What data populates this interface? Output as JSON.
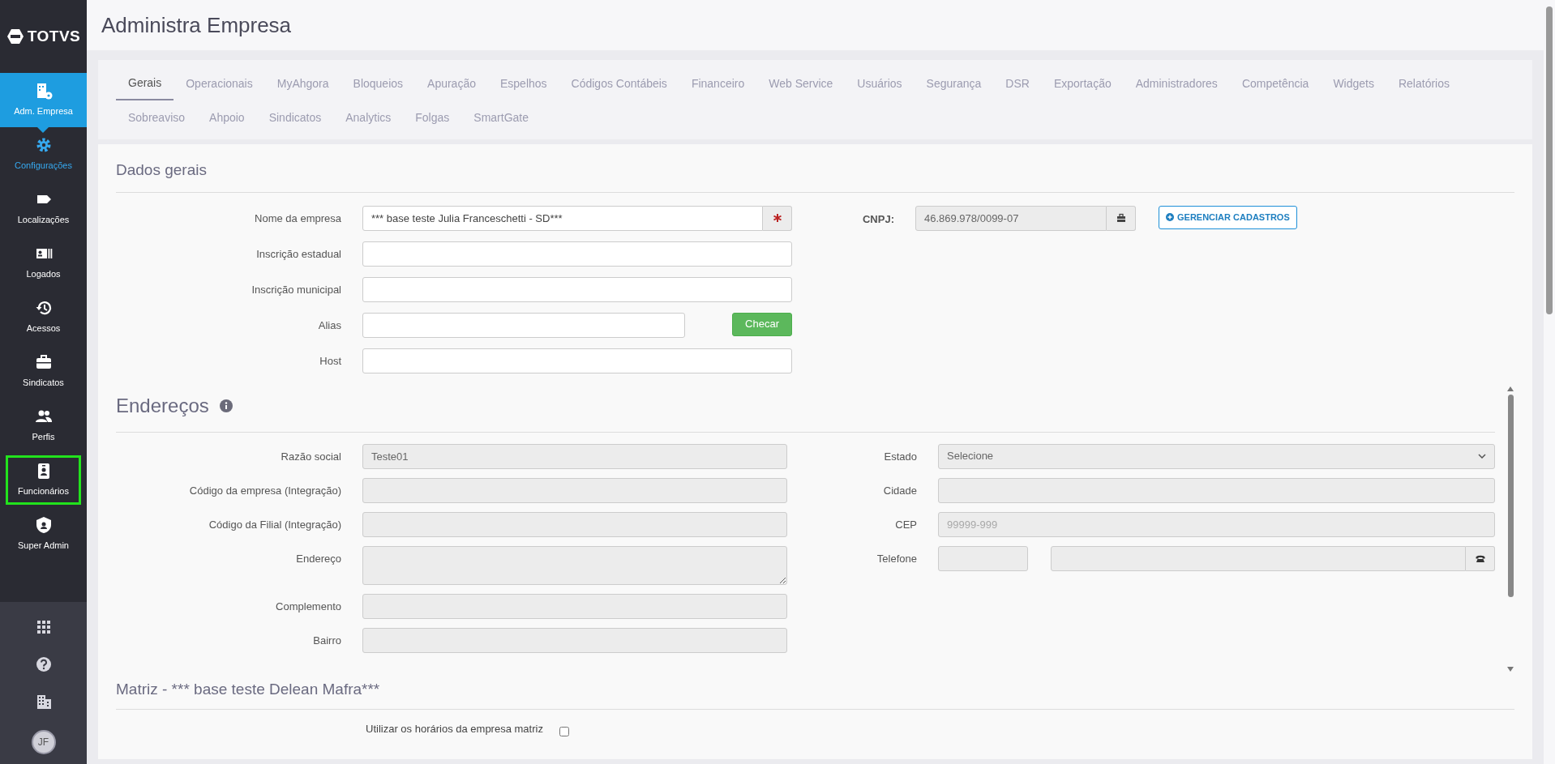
{
  "brand": "TOTVS",
  "sidebar": {
    "items": [
      {
        "label": "Adm. Empresa",
        "selected": true,
        "active": false,
        "highlighted": false
      },
      {
        "label": "Configurações",
        "selected": false,
        "active": true,
        "highlighted": false
      },
      {
        "label": "Localizações",
        "selected": false,
        "active": false,
        "highlighted": false
      },
      {
        "label": "Logados",
        "selected": false,
        "active": false,
        "highlighted": false
      },
      {
        "label": "Acessos",
        "selected": false,
        "active": false,
        "highlighted": false
      },
      {
        "label": "Sindicatos",
        "selected": false,
        "active": false,
        "highlighted": false
      },
      {
        "label": "Perfis",
        "selected": false,
        "active": false,
        "highlighted": false
      },
      {
        "label": "Funcionários",
        "selected": false,
        "active": false,
        "highlighted": true
      },
      {
        "label": "Super Admin",
        "selected": false,
        "active": false,
        "highlighted": false
      }
    ],
    "avatar": "JF"
  },
  "page_title": "Administra Empresa",
  "tabs": [
    {
      "label": "Gerais",
      "selected": true
    },
    {
      "label": "Operacionais",
      "selected": false
    },
    {
      "label": "MyAhgora",
      "selected": false
    },
    {
      "label": "Bloqueios",
      "selected": false
    },
    {
      "label": "Apuração",
      "selected": false
    },
    {
      "label": "Espelhos",
      "selected": false
    },
    {
      "label": "Códigos Contábeis",
      "selected": false
    },
    {
      "label": "Financeiro",
      "selected": false
    },
    {
      "label": "Web Service",
      "selected": false
    },
    {
      "label": "Usuários",
      "selected": false
    },
    {
      "label": "Segurança",
      "selected": false
    },
    {
      "label": "DSR",
      "selected": false
    },
    {
      "label": "Exportação",
      "selected": false
    },
    {
      "label": "Administradores",
      "selected": false
    },
    {
      "label": "Competência",
      "selected": false
    },
    {
      "label": "Widgets",
      "selected": false
    },
    {
      "label": "Relatórios",
      "selected": false
    },
    {
      "label": "Sobreaviso",
      "selected": false
    },
    {
      "label": "Ahpoio",
      "selected": false
    },
    {
      "label": "Sindicatos",
      "selected": false
    },
    {
      "label": "Analytics",
      "selected": false
    },
    {
      "label": "Folgas",
      "selected": false
    },
    {
      "label": "SmartGate",
      "selected": false
    }
  ],
  "dados_gerais": {
    "title": "Dados gerais",
    "fields": [
      {
        "label": "Nome da empresa",
        "kind": "required",
        "value": "*** base teste Julia Franceschetti - SD***"
      },
      {
        "label": "Inscrição estadual",
        "kind": "text"
      },
      {
        "label": "Inscrição municipal",
        "kind": "text"
      },
      {
        "label": "Alias",
        "kind": "check",
        "button": "Checar"
      },
      {
        "label": "Host",
        "kind": "text"
      }
    ],
    "cnpj": {
      "label": "CNPJ:",
      "value": "46.869.978/0099-07",
      "disabled": true
    },
    "manage_button": "GERENCIAR CADASTROS"
  },
  "enderecos": {
    "title": "Endereços",
    "left": [
      {
        "label": "Razão social",
        "kind": "text",
        "value": "Teste01",
        "disabled": true
      },
      {
        "label": "Código da empresa (Integração)",
        "kind": "text",
        "disabled": true
      },
      {
        "label": "Código da Filial (Integração)",
        "kind": "text",
        "disabled": true
      },
      {
        "label": "Endereço",
        "kind": "textarea",
        "disabled": true
      },
      {
        "label": "Complemento",
        "kind": "text",
        "disabled": true
      },
      {
        "label": "Bairro",
        "kind": "text",
        "disabled": true
      }
    ],
    "right": [
      {
        "label": "Estado",
        "kind": "select",
        "value": "Selecione",
        "disabled": true
      },
      {
        "label": "Cidade",
        "kind": "text",
        "disabled": true
      },
      {
        "label": "CEP",
        "kind": "text",
        "placeholder": "99999-999",
        "disabled": true
      },
      {
        "label": "Telefone",
        "kind": "phone",
        "disabled": true
      }
    ]
  },
  "matriz": {
    "title": "Matriz - *** base teste Delean Mafra***",
    "option": {
      "label": "Utilizar os horários da empresa matriz",
      "checked": false
    }
  }
}
